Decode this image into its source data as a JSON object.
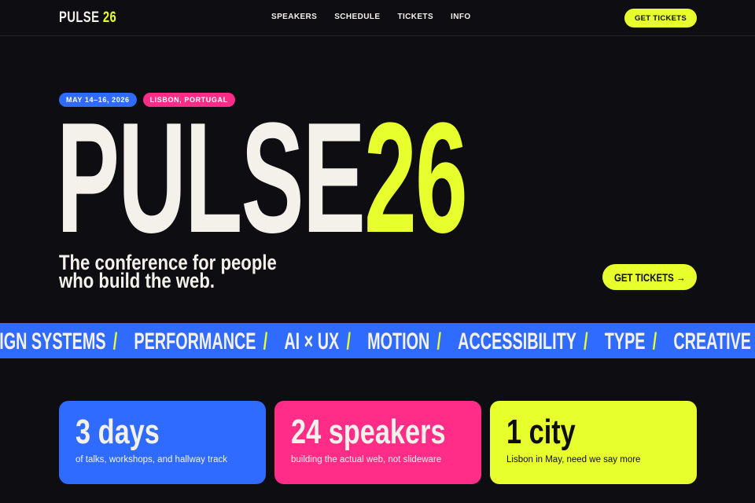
{
  "nav": {
    "logo_name": "PULSE",
    "logo_number": "26",
    "links": [
      "SPEAKERS",
      "SCHEDULE",
      "TICKETS",
      "INFO"
    ],
    "cta_label": "GET TICKETS"
  },
  "hero": {
    "badges": [
      {
        "label": "MAY 14–16, 2026",
        "color": "#2f6bff"
      },
      {
        "label": "LISBON, PORTUGAL",
        "color": "#ff2d87"
      }
    ],
    "title_word": "PULSE",
    "title_number": "26",
    "tagline_line1": "The conference for people",
    "tagline_line2": "who build the web.",
    "cta_label": "GET TICKETS →"
  },
  "marquee": {
    "items": [
      "SIGN SYSTEMS",
      "PERFORMANCE",
      "AI × UX",
      "MOTION",
      "ACCESSIBILITY",
      "TYPE",
      "CREATIVE COD"
    ],
    "separator": "/"
  },
  "stats": [
    {
      "value": "3 days",
      "caption": "of talks, workshops, and hallway track",
      "color": "#2f6bff"
    },
    {
      "value": "24 speakers",
      "caption": "building the actual web, not slideware",
      "color": "#ff2d87"
    },
    {
      "value": "1 city",
      "caption": "Lisbon in May, need we say more",
      "color": "#e8ff2e"
    }
  ],
  "colors": {
    "background": "#0d0d12",
    "accent_lime": "#e8ff2e",
    "accent_blue": "#2f6bff",
    "accent_pink": "#ff2d87",
    "text_light": "#f3f1ea"
  }
}
